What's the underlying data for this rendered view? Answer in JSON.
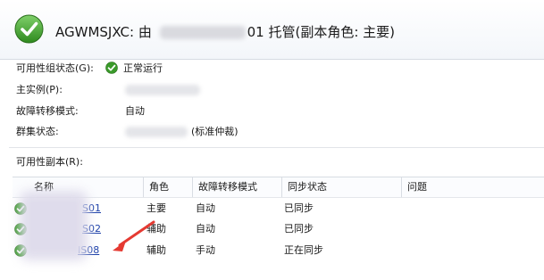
{
  "header": {
    "title_prefix": "AGWMSJXC: 由",
    "title_suffix": "01 托管(副本角色: 主要)"
  },
  "properties": {
    "ag_status_label": "可用性组状态(G):",
    "ag_status_value": "正常运行",
    "primary_label": "主实例(P):",
    "failover_label": "故障转移模式:",
    "failover_value": "自动",
    "cluster_label": "群集状态:",
    "cluster_value_suffix": "(标准仲裁)"
  },
  "replicas": {
    "section_label": "可用性副本(R):",
    "columns": [
      "名称",
      "角色",
      "故障转移模式",
      "同步状态",
      "问题"
    ],
    "rows": [
      {
        "name": "S01",
        "role": "主要",
        "failover": "自动",
        "sync": "已同步"
      },
      {
        "name": "S02",
        "role": "辅助",
        "failover": "自动",
        "sync": "已同步"
      },
      {
        "name": "IS08",
        "role": "辅助",
        "failover": "手动",
        "sync": "正在同步"
      }
    ]
  },
  "colors": {
    "ok_green": "#3a9a2a",
    "link_blue": "#1a3ea8",
    "annotation_red": "#e53a32"
  },
  "icons": {
    "header": "check-circle-icon",
    "status": "check-circle-icon",
    "row": "check-circle-icon"
  }
}
